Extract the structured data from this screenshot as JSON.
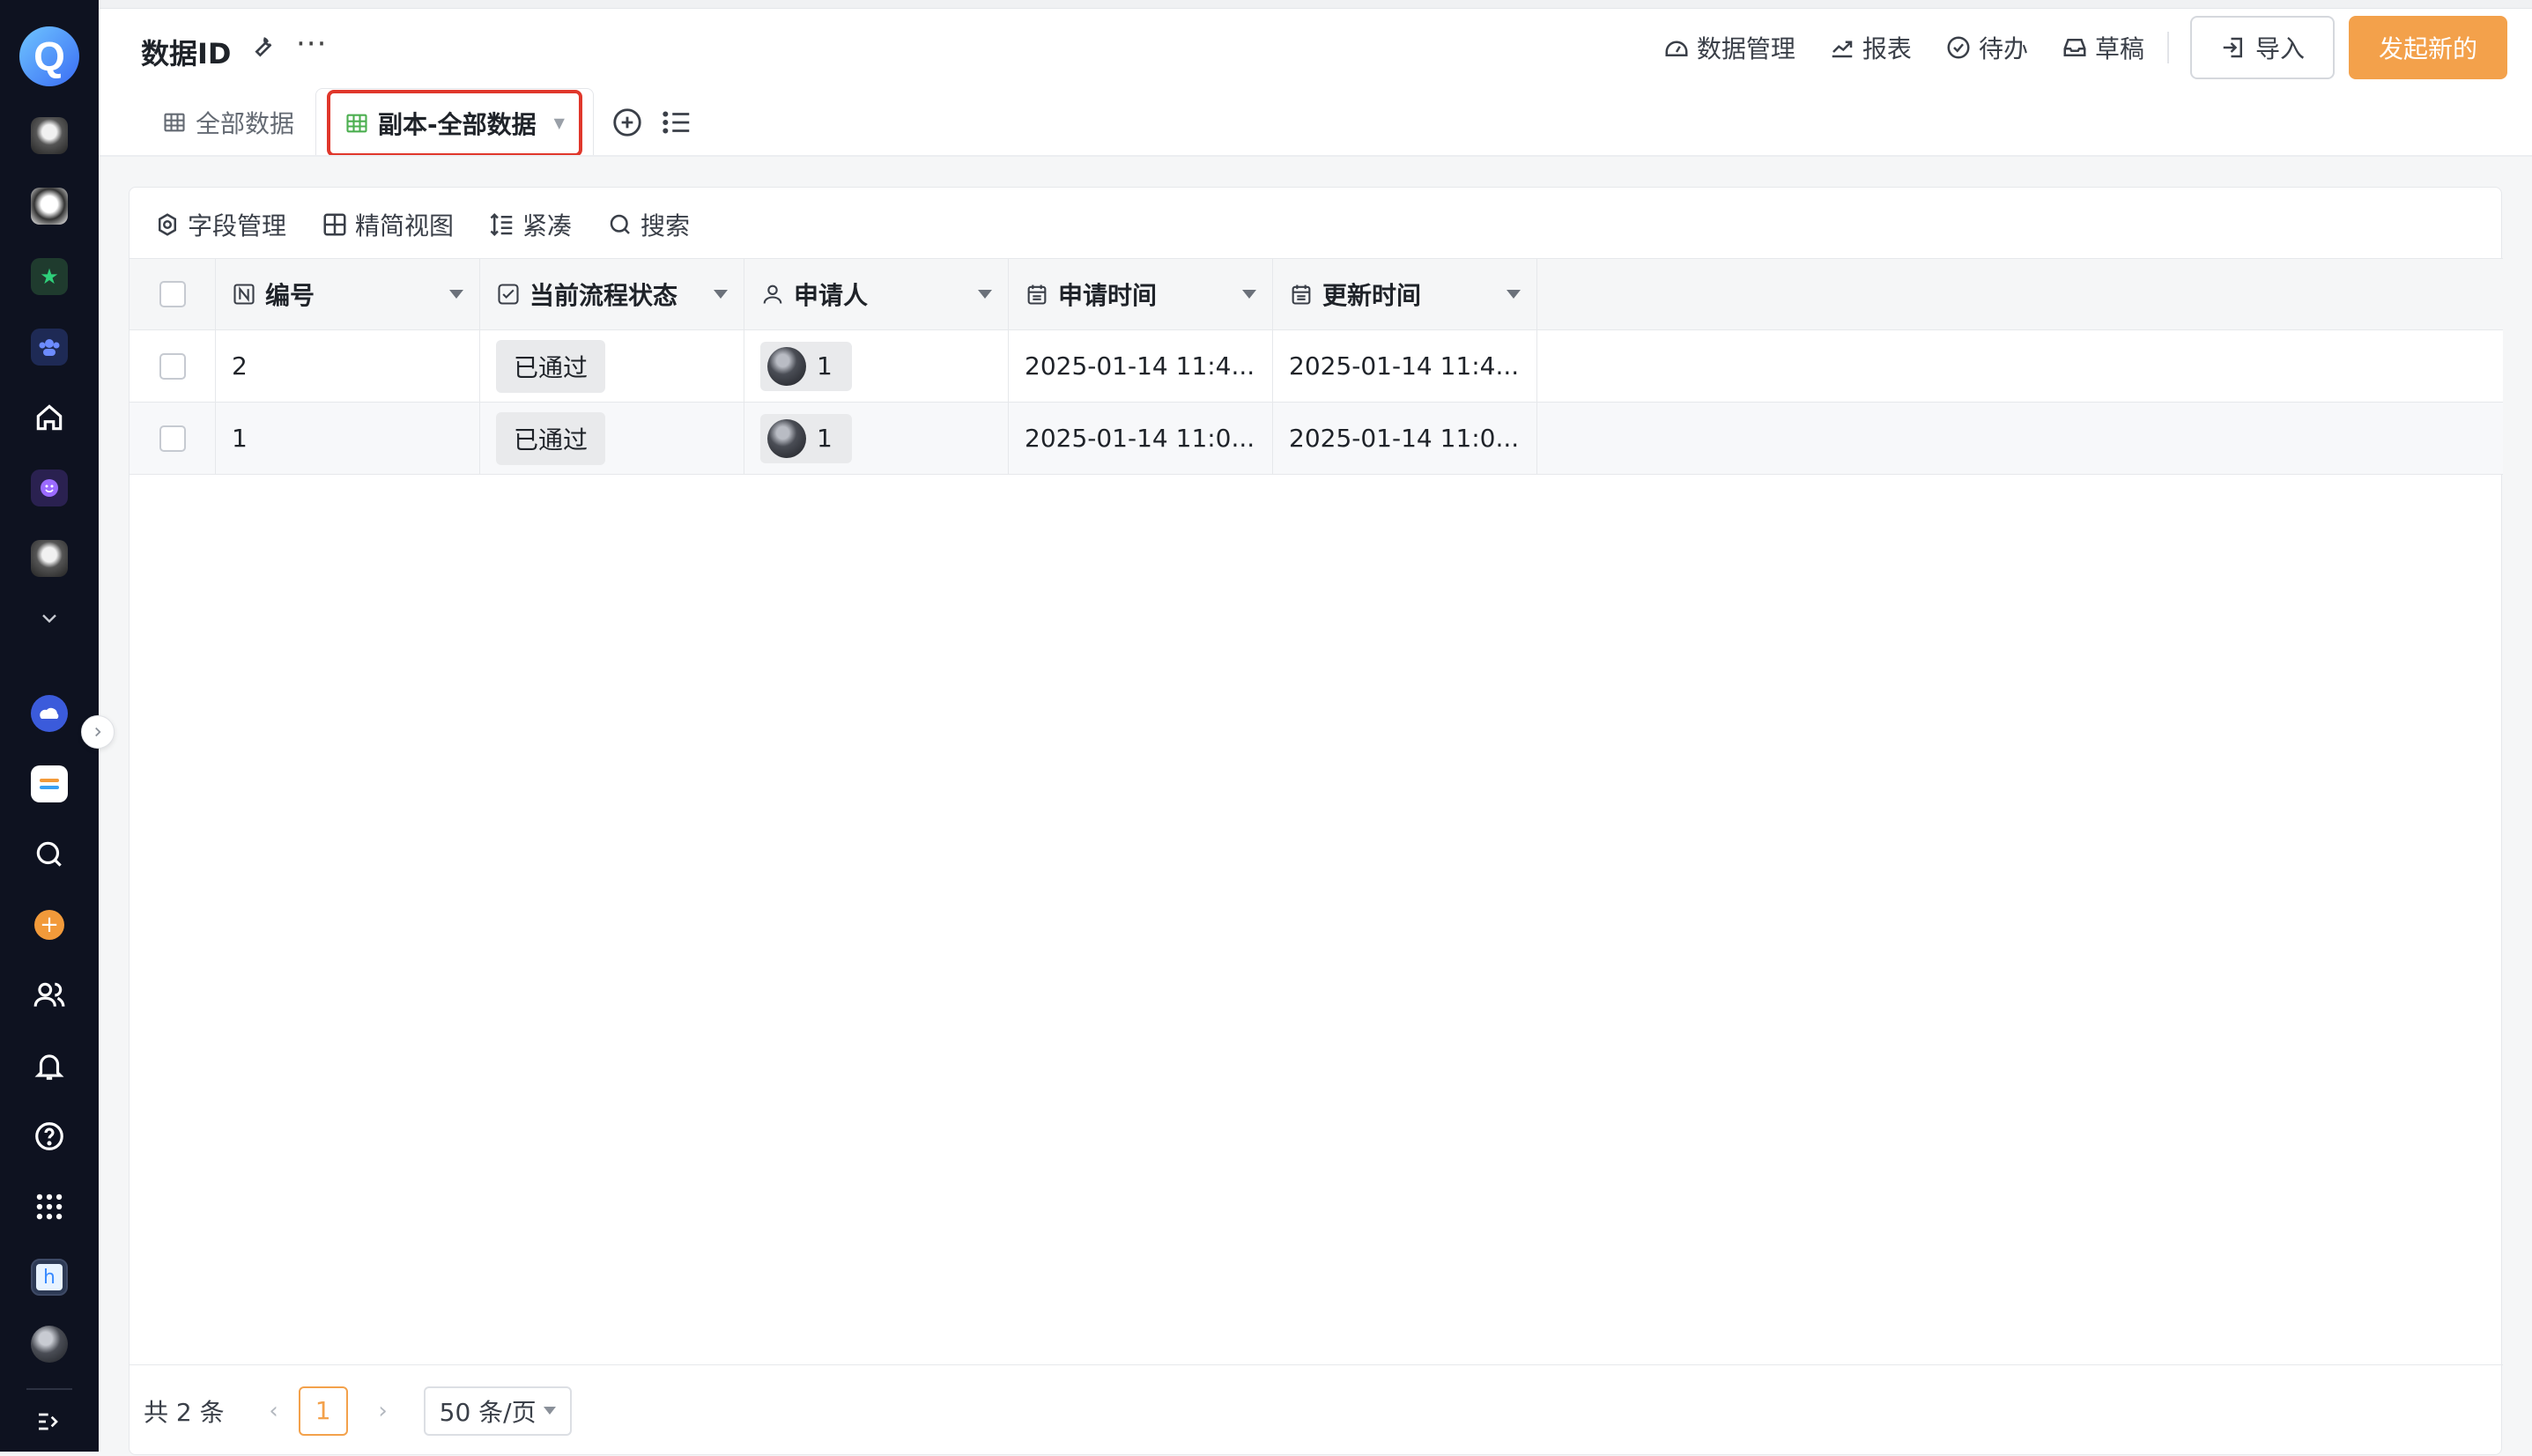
{
  "header": {
    "title": "数据ID",
    "more": "···",
    "links": [
      {
        "label": "数据管理",
        "icon": "dashboard-icon"
      },
      {
        "label": "报表",
        "icon": "trend-chart-icon"
      },
      {
        "label": "待办",
        "icon": "check-circle-icon"
      },
      {
        "label": "草稿",
        "icon": "inbox-icon"
      }
    ],
    "import_label": "导入",
    "new_label": "发起新的",
    "accent": "#f3a14b"
  },
  "tabs": [
    {
      "label": "全部数据",
      "icon": "table-icon",
      "active": false
    },
    {
      "label": "副本-全部数据",
      "icon": "table-icon",
      "active": true
    }
  ],
  "toolbar": {
    "fields": "字段管理",
    "compact_view": "精简视图",
    "dense": "紧凑",
    "search": "搜索"
  },
  "table": {
    "columns": [
      {
        "label": "编号",
        "icon": "number-field-icon"
      },
      {
        "label": "当前流程状态",
        "icon": "checkbox-field-icon"
      },
      {
        "label": "申请人",
        "icon": "person-icon"
      },
      {
        "label": "申请时间",
        "icon": "calendar-icon"
      },
      {
        "label": "更新时间",
        "icon": "calendar-icon"
      }
    ],
    "rows": [
      {
        "id": "2",
        "status": "已通过",
        "applicant": "1",
        "applied": "2025-01-14 11:4...",
        "updated": "2025-01-14 11:4..."
      },
      {
        "id": "1",
        "status": "已通过",
        "applicant": "1",
        "applied": "2025-01-14 11:0...",
        "updated": "2025-01-14 11:0..."
      }
    ]
  },
  "footer": {
    "total": "共 2 条",
    "page": "1",
    "page_size": "50 条/页"
  },
  "rail": {
    "logo_letter": "Q",
    "tile_letter": "h"
  }
}
